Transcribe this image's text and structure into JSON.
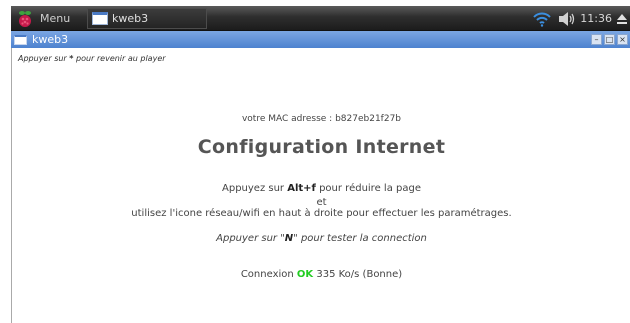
{
  "taskbar": {
    "menu_label": "Menu",
    "task_label": "kweb3",
    "clock": "11:36"
  },
  "window": {
    "title": "kweb3"
  },
  "page": {
    "hint_prefix": "Appuyer sur ",
    "hint_key": "*",
    "hint_suffix": " pour revenir au player",
    "mac_line": "votre MAC adresse : b827eb21f27b",
    "heading": "Configuration Internet",
    "line1_prefix": "Appuyez sur ",
    "line1_key": "Alt+f",
    "line1_suffix": " pour réduire la page",
    "line2": "et",
    "line3": "utilisez l'icone réseau/wifi en haut à droite pour effectuer les paramétrages.",
    "line4_prefix": "Appuyer sur \"",
    "line4_key": "N",
    "line4_suffix": "\" pour tester la connection",
    "status_prefix": "Connexion ",
    "status_ok": "OK",
    "status_suffix": " 335 Ko/s (Bonne)"
  },
  "colors": {
    "taskbar": "#2e2e2e",
    "titlebar": "#5b8dd6",
    "ok": "#22cc22",
    "heading": "#555555"
  },
  "icons": {
    "menu": "raspberry-pi-icon",
    "task": "window-icon",
    "wifi": "wifi-icon",
    "volume": "volume-icon",
    "eject": "eject-icon"
  }
}
